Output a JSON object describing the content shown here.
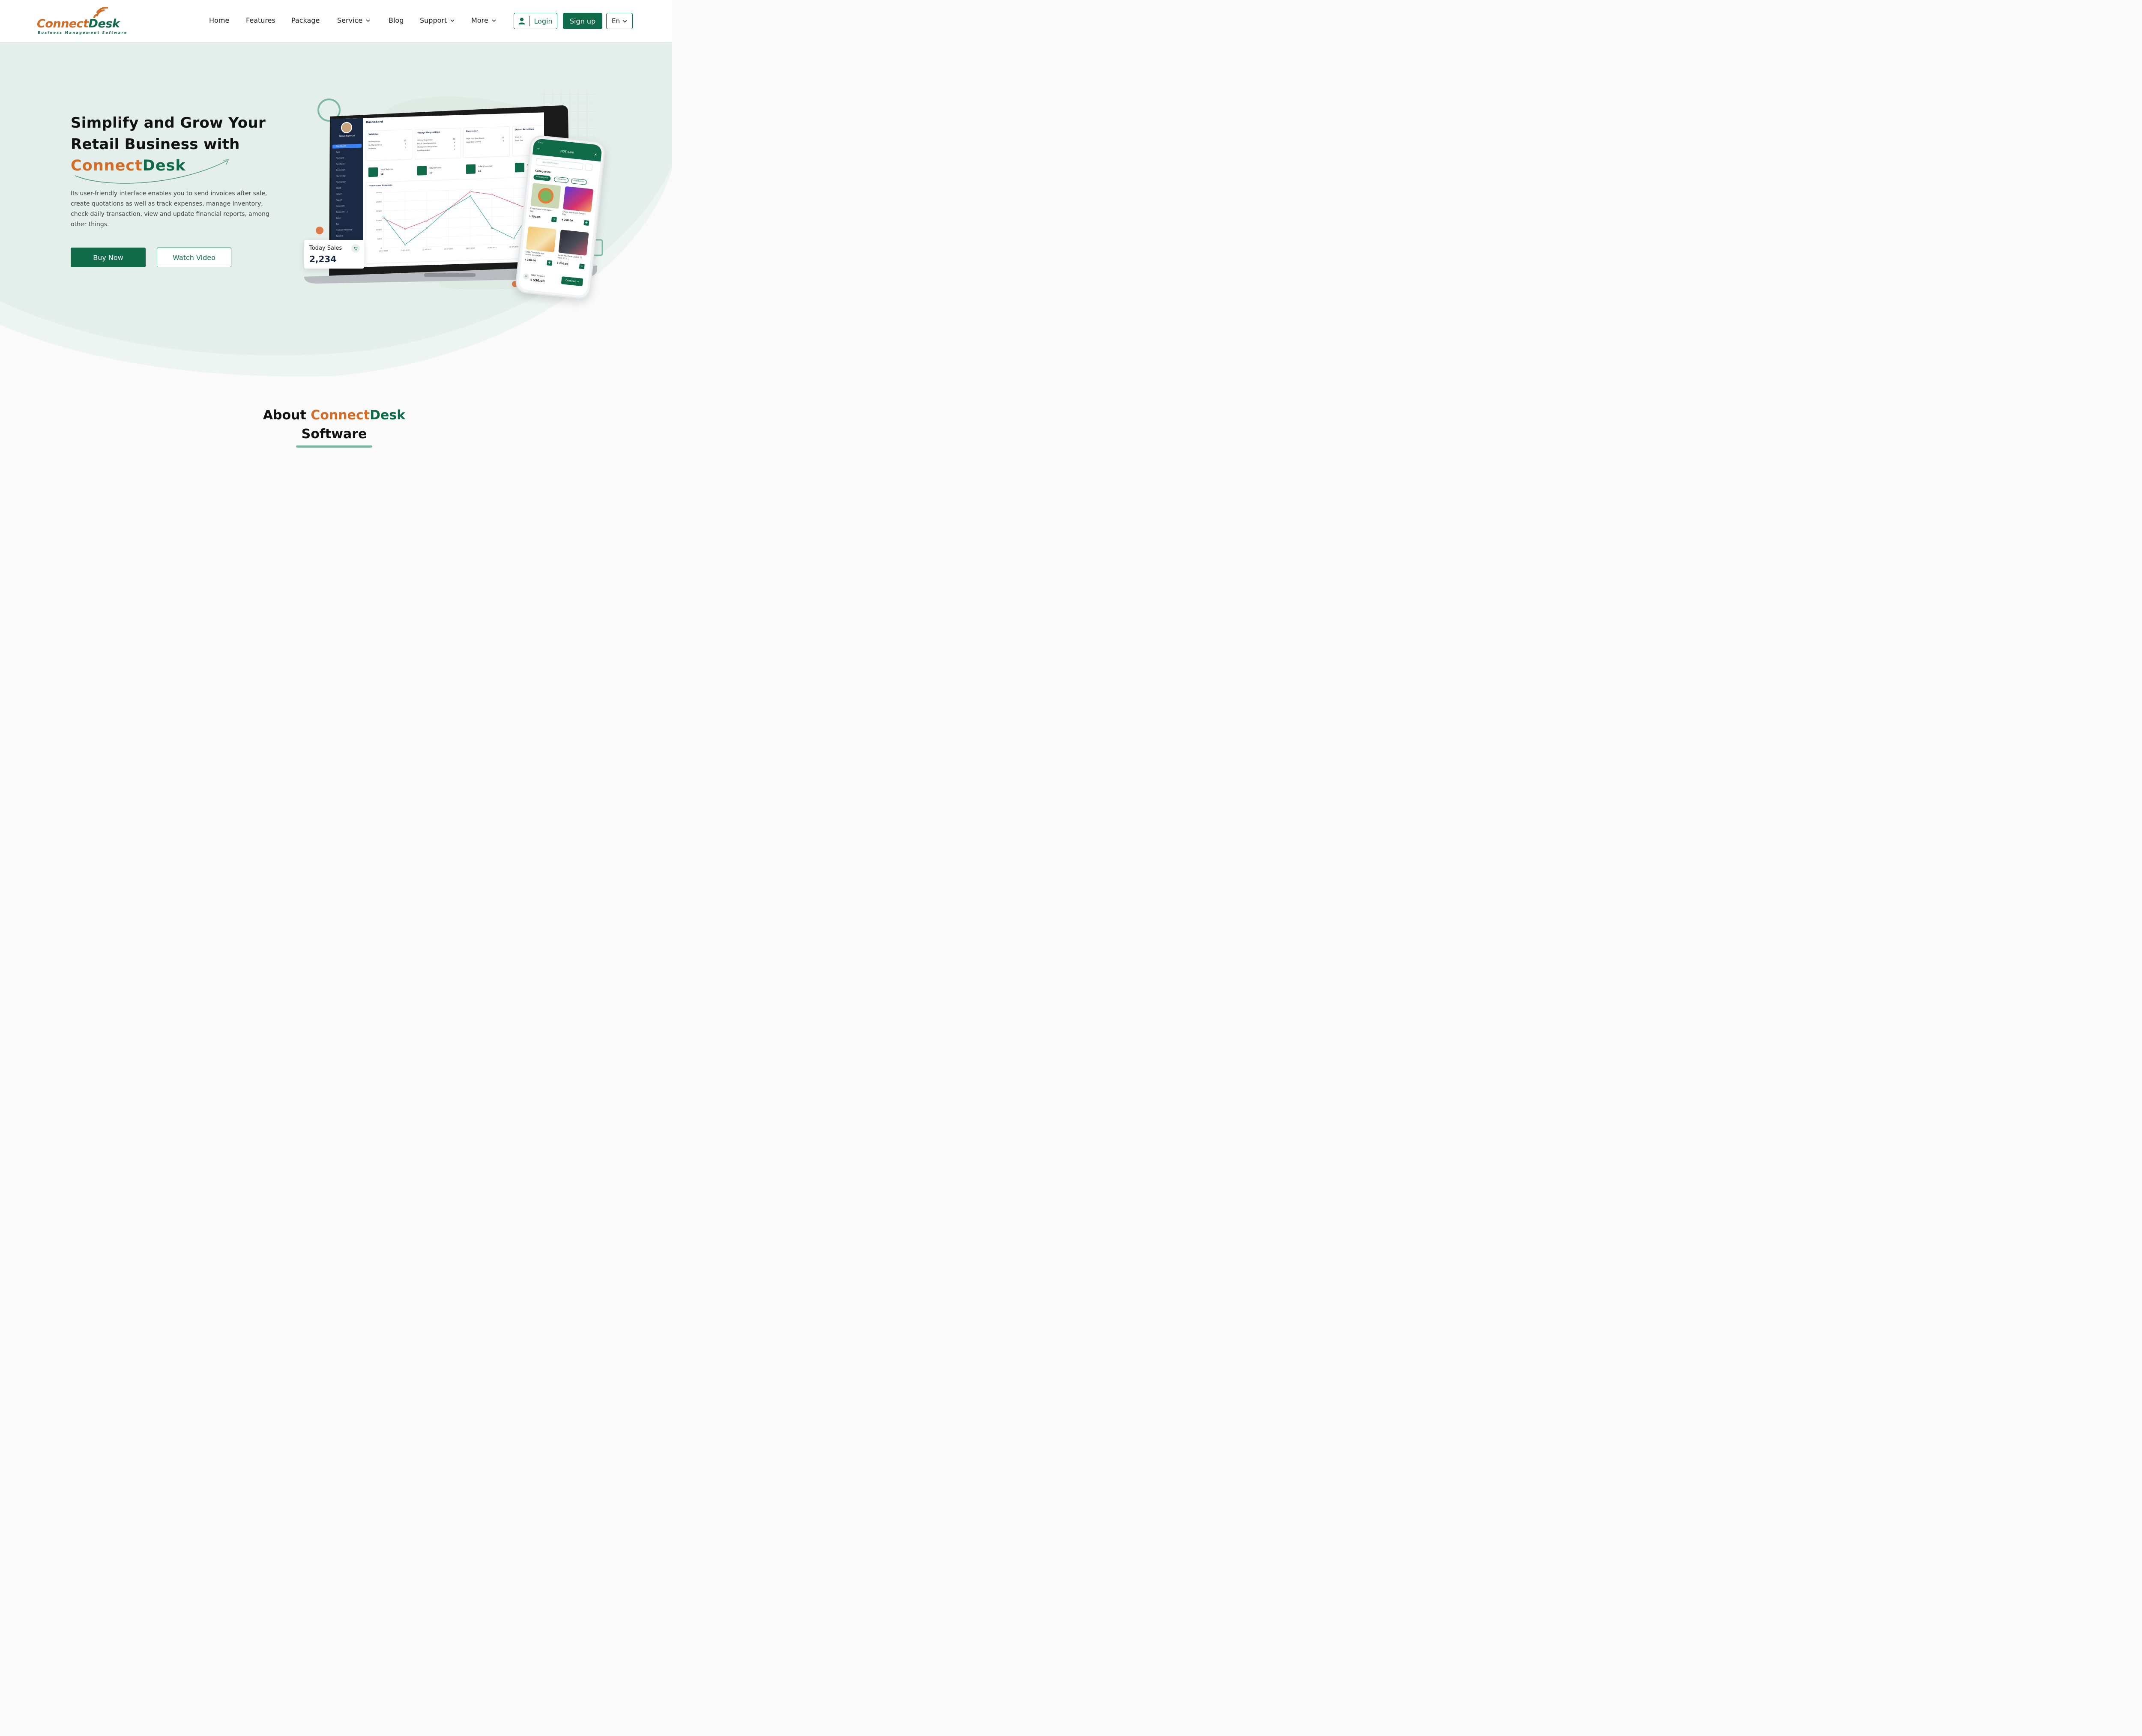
{
  "brand": {
    "logo_part1": "Connect",
    "logo_part2": "Desk",
    "tagline": "Business Management Software",
    "colors": {
      "primary": "#0f6b48",
      "accent": "#d36c25"
    }
  },
  "nav": {
    "items": [
      {
        "label": "Home",
        "dropdown": false
      },
      {
        "label": "Features",
        "dropdown": false
      },
      {
        "label": "Package",
        "dropdown": false
      },
      {
        "label": "Service",
        "dropdown": true
      },
      {
        "label": "Blog",
        "dropdown": false
      },
      {
        "label": "Support",
        "dropdown": true
      },
      {
        "label": "More",
        "dropdown": true
      }
    ],
    "login_label": "Login",
    "signup_label": "Sign up",
    "language": "En"
  },
  "hero": {
    "title_line1": "Simplify and Grow Your",
    "title_line2": "Retail Business with",
    "brand_part1": "Connect",
    "brand_part2": "Desk",
    "description": "Its user-friendly interface enables you to send invoices after sale, create quotations as well as track expenses, manage inventory, check daily transaction, view and update financial reports, among other things.",
    "buy_label": "Buy Now",
    "watch_label": "Watch Video"
  },
  "dashboard": {
    "title": "Dashboard",
    "user_name": "Tanvir Rahman",
    "sidebar": [
      "Dashboard",
      "Sale",
      "Products",
      "Purchase",
      "Quotation",
      "Marketing",
      "Production",
      "Stock",
      "Return",
      "Report",
      "Accounts",
      "Accounts - 2",
      "Bank",
      "Tax",
      "Human Resource",
      "Service"
    ],
    "cards": [
      {
        "title": "Vehicles",
        "rows": [
          [
            "On Requisition",
            "15"
          ],
          [
            "On Maintenance",
            "9"
          ],
          [
            "Available",
            "2"
          ]
        ]
      },
      {
        "title": "Todays Requisition",
        "rows": [
          [
            "Vehicle Requisition",
            "15"
          ],
          [
            "Pick & Drop Requisition",
            "9"
          ],
          [
            "Maintenance Requisition",
            "2"
          ],
          [
            "Fuel Requisition",
            "2"
          ]
        ]
      },
      {
        "title": "Reminder",
        "rows": [
          [
            "Legal Doc Soon Expire",
            "15"
          ],
          [
            "Legal Doc Expired",
            "9"
          ]
        ]
      },
      {
        "title": "Other Activities",
        "rows": [
          [
            "Stock In",
            "15"
          ],
          [
            "Stock Out",
            ""
          ]
        ]
      }
    ],
    "stats": [
      {
        "label": "Total Vehicles",
        "value": "10"
      },
      {
        "label": "Total Drivers",
        "value": "10"
      },
      {
        "label": "Total Customer",
        "value": "10"
      },
      {
        "label": "Total",
        "value": "10"
      }
    ],
    "chart_title": "Income and Expenses",
    "today_sales_label": "Today Sales",
    "today_sales_value": "2,234"
  },
  "chart_data": {
    "type": "line",
    "title": "Income and Expenses",
    "x": [
      "20-07-2020",
      "21-07-2020",
      "22-07-2020",
      "23-07-2020",
      "24-07-2020",
      "25-07-2020",
      "26-07-2020",
      "27-07-2020"
    ],
    "ylim": [
      0,
      30000
    ],
    "yticks": [
      0,
      5000,
      10000,
      15000,
      20000,
      25000,
      30000
    ],
    "series": [
      {
        "color": "#e0566d",
        "values": [
          16000,
          10000,
          14000,
          20000,
          29000,
          27000,
          22000,
          17000
        ]
      },
      {
        "color": "#2aa198",
        "values": [
          17000,
          1500,
          10000,
          20000,
          26500,
          9000,
          3000,
          22000
        ]
      }
    ]
  },
  "phone": {
    "time": "9:41",
    "title": "POS Sale",
    "search_placeholder": "Search Product",
    "categories_label": "Categories",
    "chips": [
      "All Category",
      "Groceries",
      "Electronics"
    ],
    "products": [
      {
        "name": "Chess Salad with Boiled Egg",
        "price": "৳ 250.00"
      },
      {
        "name": "Chess Salad with Boiled Egg",
        "price": "৳ 250.00"
      },
      {
        "name": "Igloo Chocolate plus vanilla ice-cream",
        "price": "৳ 250.00"
      },
      {
        "name": "Apple MacBook Laptop 15 inch, M1 C...",
        "price": "৳ 250.00"
      }
    ],
    "count": "02",
    "total_label": "Total Amount",
    "total_value": "৳ 550.00",
    "continue_label": "Continue →"
  },
  "about": {
    "prefix": "About ",
    "brand_part1": "Connect",
    "brand_part2": "Desk",
    "suffix": "Software"
  }
}
